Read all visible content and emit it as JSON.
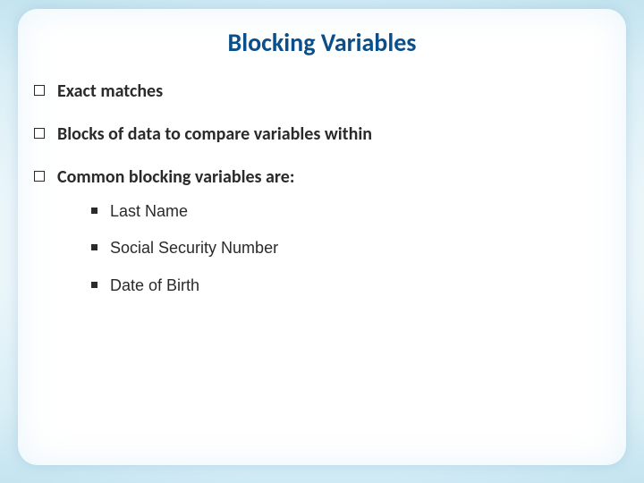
{
  "slide": {
    "title": "Blocking Variables",
    "bullets": [
      {
        "text": "Exact matches"
      },
      {
        "text": "Blocks of data to compare variables within"
      },
      {
        "text": "Common blocking variables are:",
        "sub": [
          "Last Name",
          "Social Security Number",
          "Date of Birth"
        ]
      }
    ]
  }
}
